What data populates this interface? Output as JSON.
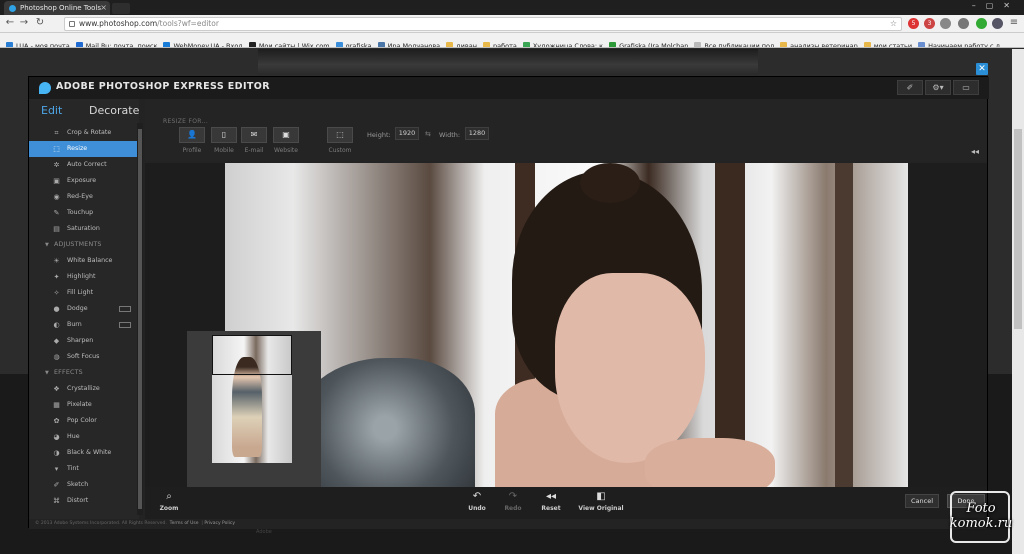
{
  "browser": {
    "tab_title": "Photoshop Online Tools",
    "url_host": "www.photoshop.com",
    "url_path": "/tools?wf=editor",
    "bookmarks": [
      {
        "label": "LUA - моя почта",
        "color": "#2a7fd4"
      },
      {
        "label": "Mail.Ru: почта, поиск",
        "color": "#1f6bd1"
      },
      {
        "label": "WebMoney.UA - Вход",
        "color": "#1a7ed8"
      },
      {
        "label": "Мои сайты | Wix.com",
        "color": "#222222"
      },
      {
        "label": "grafiska",
        "color": "#3b8ed9"
      },
      {
        "label": "Ира Молчанова",
        "color": "#4a76a8"
      },
      {
        "label": "диван",
        "color": "#e8b84a"
      },
      {
        "label": "работа",
        "color": "#e8b84a"
      },
      {
        "label": "Художница Слова: к",
        "color": "#3aa655"
      },
      {
        "label": "Grafiska (Ira Molchan",
        "color": "#2e9a3a"
      },
      {
        "label": "Все публикации пол",
        "color": "#bbbbbb"
      },
      {
        "label": "анализы ветеринар",
        "color": "#e8b84a"
      },
      {
        "label": "мои статьи",
        "color": "#e8b84a"
      },
      {
        "label": "Начинаем работу с д",
        "color": "#6a8fd0"
      }
    ]
  },
  "editor": {
    "title": "ADOBE PHOTOSHOP EXPRESS EDITOR",
    "modes": {
      "edit": "Edit",
      "decorate": "Decorate"
    },
    "tools_top": [
      {
        "label": "Crop & Rotate",
        "icon": "crop-icon",
        "glyph": "⌗"
      },
      {
        "label": "Resize",
        "icon": "resize-icon",
        "glyph": "⬚",
        "active": true
      },
      {
        "label": "Auto Correct",
        "icon": "auto-correct-icon",
        "glyph": "✲"
      },
      {
        "label": "Exposure",
        "icon": "exposure-icon",
        "glyph": "▣"
      },
      {
        "label": "Red-Eye",
        "icon": "eye-icon",
        "glyph": "◉"
      },
      {
        "label": "Touchup",
        "icon": "brush-icon",
        "glyph": "✎"
      },
      {
        "label": "Saturation",
        "icon": "saturation-icon",
        "glyph": "▤"
      }
    ],
    "adjustments_label": "ADJUSTMENTS",
    "adjustments": [
      {
        "label": "White Balance",
        "icon": "white-balance-icon",
        "glyph": "☀"
      },
      {
        "label": "Highlight",
        "icon": "highlight-icon",
        "glyph": "✦"
      },
      {
        "label": "Fill Light",
        "icon": "fill-light-icon",
        "glyph": "✧"
      },
      {
        "label": "Dodge",
        "icon": "dodge-icon",
        "glyph": "●",
        "badge": true
      },
      {
        "label": "Burn",
        "icon": "burn-icon",
        "glyph": "◐",
        "badge": true
      },
      {
        "label": "Sharpen",
        "icon": "sharpen-icon",
        "glyph": "◆"
      },
      {
        "label": "Soft Focus",
        "icon": "soft-focus-icon",
        "glyph": "◍"
      }
    ],
    "effects_label": "EFFECTS",
    "effects": [
      {
        "label": "Crystallize",
        "icon": "crystallize-icon",
        "glyph": "❖"
      },
      {
        "label": "Pixelate",
        "icon": "pixelate-icon",
        "glyph": "▦"
      },
      {
        "label": "Pop Color",
        "icon": "pop-color-icon",
        "glyph": "✿"
      },
      {
        "label": "Hue",
        "icon": "hue-icon",
        "glyph": "◕"
      },
      {
        "label": "Black & White",
        "icon": "black-white-icon",
        "glyph": "◑"
      },
      {
        "label": "Tint",
        "icon": "tint-icon",
        "glyph": "▾"
      },
      {
        "label": "Sketch",
        "icon": "sketch-icon",
        "glyph": "✐"
      },
      {
        "label": "Distort",
        "icon": "distort-icon",
        "glyph": "⌘"
      }
    ],
    "resize": {
      "section_label": "RESIZE FOR...",
      "presets": [
        {
          "label": "Profile",
          "icon": "profile-icon",
          "glyph": "👤"
        },
        {
          "label": "Mobile",
          "icon": "mobile-icon",
          "glyph": "▯"
        },
        {
          "label": "E-mail",
          "icon": "email-icon",
          "glyph": "✉"
        },
        {
          "label": "Website",
          "icon": "website-icon",
          "glyph": "▣"
        }
      ],
      "custom": {
        "label": "Custom",
        "icon": "custom-size-icon",
        "glyph": "⬚"
      },
      "height_label": "Height:",
      "height_value": "1920",
      "width_label": "Width:",
      "width_value": "1280"
    },
    "bottom": {
      "zoom": "Zoom",
      "undo": "Undo",
      "redo": "Redo",
      "reset": "Reset",
      "view_original": "View Original",
      "cancel": "Cancel",
      "done": "Done"
    },
    "footer": {
      "copyright": "© 2013 Adobe Systems Incorporated. All Rights Reserved.",
      "terms": "Terms of Use",
      "privacy": "Privacy Policy"
    }
  },
  "page": {
    "under_label": "Adobe"
  },
  "watermark": {
    "line1": "Foto",
    "line2": "komok.ru"
  }
}
